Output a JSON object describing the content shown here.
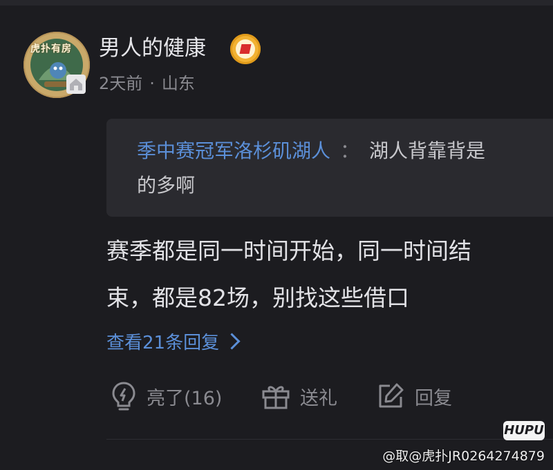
{
  "user": {
    "name": "男人的健康",
    "avatar_badge": "虎扑有房",
    "time": "2天前",
    "separator": "·",
    "location": "山东"
  },
  "quote": {
    "author": "季中赛冠军洛杉矶湖人",
    "colon": "：",
    "text_line1": "湖人背靠背是",
    "text_line2": "的多啊"
  },
  "comment": {
    "line1": "赛季都是同一时间开始，同一时间结",
    "line2": "束，都是82场，别找这些借口"
  },
  "replies_link": "查看21条回复",
  "actions": {
    "like_label": "亮了(16)",
    "gift_label": "送礼",
    "reply_label": "回复"
  },
  "watermark": {
    "logo": "HUPU",
    "text": "@取@虎扑JR0264274879"
  },
  "colors": {
    "background": "#1c1c20",
    "quote_bg": "#2a2a2f",
    "link": "#5b8fd8",
    "muted": "#8a8a90",
    "verify": "#f2b233"
  },
  "icons": [
    "lightbulb-icon",
    "gift-icon",
    "edit-reply-icon",
    "chevron-right-icon",
    "verified-badge-icon"
  ]
}
